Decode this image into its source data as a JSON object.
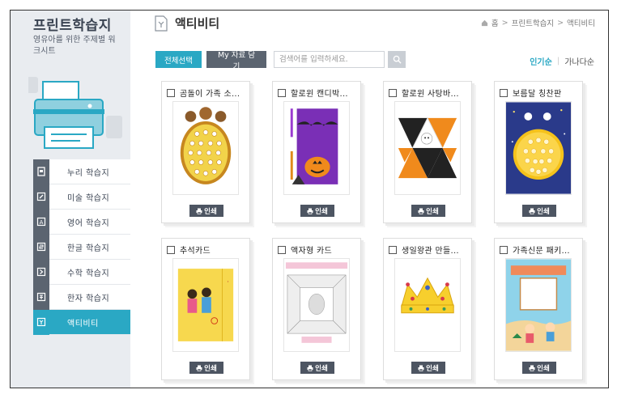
{
  "sidebar": {
    "title": "프린트학습지",
    "subtitle": "영유아를 위한 주제별 워크시트",
    "items": [
      {
        "label": "누리 학습지",
        "icon": "note-icon",
        "active": false
      },
      {
        "label": "미술 학습지",
        "icon": "pencil-icon",
        "active": false
      },
      {
        "label": "영어 학습지",
        "icon": "letter-a-icon",
        "active": false
      },
      {
        "label": "한글 학습지",
        "icon": "hangul-icon",
        "active": false
      },
      {
        "label": "수학 학습지",
        "icon": "math-icon",
        "active": false
      },
      {
        "label": "한자 학습지",
        "icon": "hanja-icon",
        "active": false
      },
      {
        "label": "액티비티",
        "icon": "activity-icon",
        "active": true
      }
    ]
  },
  "header": {
    "title": "액티비티",
    "breadcrumb": [
      "홈",
      "프린트학습지",
      "액티비티"
    ]
  },
  "toolbar": {
    "select_all": "전체선택",
    "my_save": "My 자료 담기",
    "search_placeholder": "검색어를 입력하세요."
  },
  "sort": {
    "popular": "인기순",
    "alpha": "가나다순"
  },
  "cards": [
    {
      "title": "곰돌이 가족 소...",
      "print": "인쇄"
    },
    {
      "title": "할로윈 캔디박...",
      "print": "인쇄"
    },
    {
      "title": "할로윈 사탕바...",
      "print": "인쇄"
    },
    {
      "title": "보름달 칭찬판",
      "print": "인쇄"
    },
    {
      "title": "추석카드",
      "print": "인쇄"
    },
    {
      "title": "액자형 카드",
      "print": "인쇄"
    },
    {
      "title": "생일왕관 만들...",
      "print": "인쇄"
    },
    {
      "title": "가족신문 패키...",
      "print": "인쇄"
    }
  ],
  "colors": {
    "accent": "#2aa8c4",
    "dark": "#5b6470",
    "sidebar_bg": "#e9ecf0"
  }
}
